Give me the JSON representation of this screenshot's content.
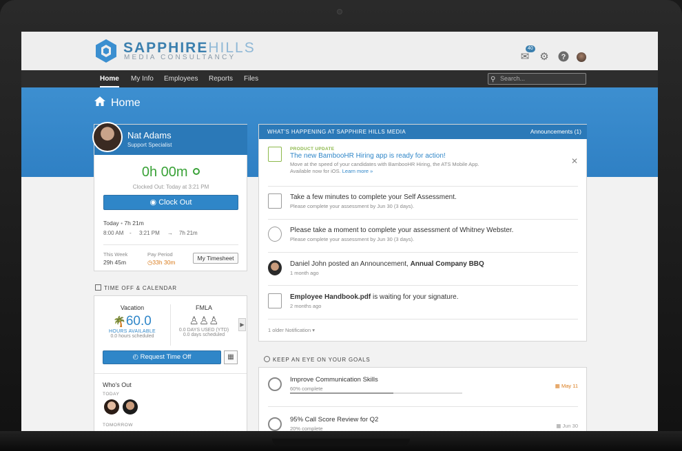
{
  "brand": {
    "name_bold": "SAPPHIRE",
    "name_light": "HILLS",
    "tagline": "MEDIA CONSULTANCY"
  },
  "header": {
    "inbox_badge": "40"
  },
  "nav": {
    "items": [
      "Home",
      "My Info",
      "Employees",
      "Reports",
      "Files"
    ],
    "search_placeholder": "Search..."
  },
  "page": {
    "title": "Home"
  },
  "profile": {
    "name": "Nat Adams",
    "role": "Support Specialist",
    "clock_time": "0h 00m",
    "clock_status": "Clocked Out: Today at 3:21 PM",
    "clock_button": "Clock Out",
    "today_label": "Today",
    "today_total": "7h 21m",
    "time_in": "8:00 AM",
    "time_dash": "-",
    "time_out": "3:21 PM",
    "time_arrow": "→",
    "time_total": "7h 21m",
    "this_week_label": "This Week",
    "this_week_value": "29h 45m",
    "pay_period_label": "Pay Period",
    "pay_period_value": "33h 30m",
    "timesheet_button": "My Timesheet"
  },
  "time_off": {
    "section_title": "TIME OFF & CALENDAR",
    "vacation": {
      "name": "Vacation",
      "value": "60.0",
      "unit": "HOURS AVAILABLE",
      "scheduled": "0.0 hours scheduled"
    },
    "fmla": {
      "name": "FMLA",
      "used": "0.0 DAYS USED (YTD)",
      "scheduled": "0.0 days scheduled"
    },
    "request_button": "Request Time Off",
    "whos_out_title": "Who's Out",
    "today_label": "TODAY",
    "tomorrow_label": "TOMORROW"
  },
  "news": {
    "title": "WHAT'S HAPPENING AT SAPPHIRE HILLS MEDIA",
    "announcements": "Announcements (1)",
    "update_tag": "PRODUCT UPDATE",
    "update_title": "The new BambooHR Hiring app is ready for action!",
    "update_desc1": "Move at the speed of your candidates with BambooHR Hiring, the ATS Mobile App.",
    "update_desc2": "Available now for iOS.",
    "update_learn": "Learn more »",
    "items": [
      {
        "title": "Take a few minutes to complete your Self Assessment.",
        "sub": "Please complete your assessment by Jun 30 (3 days)."
      },
      {
        "title": "Please take a moment to complete your assessment of Whitney Webster.",
        "sub": "Please complete your assessment by Jun 30 (3 days)."
      },
      {
        "title_pre": "Daniel John posted an Announcement, ",
        "title_bold": "Annual Company BBQ",
        "sub": "1 month ago"
      },
      {
        "title_bold": "Employee Handbook.pdf",
        "title_post": " is waiting for your signature.",
        "sub": "2 months ago"
      }
    ],
    "older": "1 older Notification ▾"
  },
  "goals": {
    "section_title": "KEEP AN EYE ON YOUR GOALS",
    "items": [
      {
        "title": "Improve Communication Skills",
        "pct": "60% complete",
        "progress": 0.6,
        "due": "May 11"
      },
      {
        "title": "95% Call Score Review for Q2",
        "pct": "20% complete",
        "progress": 0.2,
        "due": "Jun 30"
      }
    ]
  },
  "colors": {
    "brand_blue": "#2f86c8",
    "clock_green": "#3aa238",
    "due_orange": "#d97a1a"
  }
}
